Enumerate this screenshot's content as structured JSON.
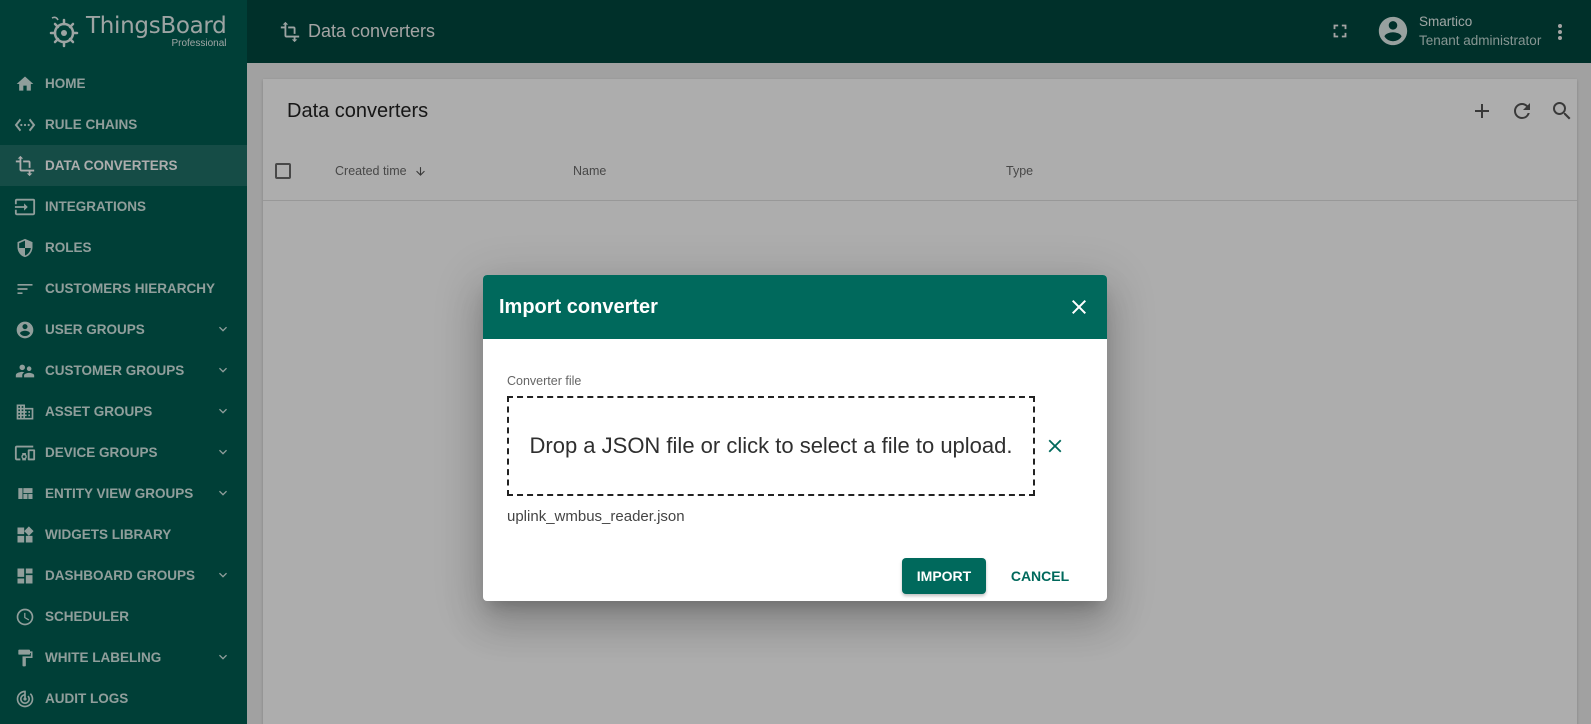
{
  "app": {
    "brand": "ThingsBoard",
    "edition": "Professional"
  },
  "sidebar": {
    "items": [
      {
        "label": "HOME",
        "icon": "home-icon"
      },
      {
        "label": "RULE CHAINS",
        "icon": "settings-ethernet-icon"
      },
      {
        "label": "DATA CONVERTERS",
        "icon": "transform-icon",
        "active": true
      },
      {
        "label": "INTEGRATIONS",
        "icon": "input-icon"
      },
      {
        "label": "ROLES",
        "icon": "shield-icon"
      },
      {
        "label": "CUSTOMERS HIERARCHY",
        "icon": "sort-icon"
      },
      {
        "label": "USER GROUPS",
        "icon": "account-circle-icon",
        "expandable": true
      },
      {
        "label": "CUSTOMER GROUPS",
        "icon": "supervisor-account-icon",
        "expandable": true
      },
      {
        "label": "ASSET GROUPS",
        "icon": "domain-icon",
        "expandable": true
      },
      {
        "label": "DEVICE GROUPS",
        "icon": "devices-other-icon",
        "expandable": true
      },
      {
        "label": "ENTITY VIEW GROUPS",
        "icon": "view-quilt-icon",
        "expandable": true
      },
      {
        "label": "WIDGETS LIBRARY",
        "icon": "widgets-icon"
      },
      {
        "label": "DASHBOARD GROUPS",
        "icon": "dashboard-icon",
        "expandable": true
      },
      {
        "label": "SCHEDULER",
        "icon": "schedule-icon"
      },
      {
        "label": "WHITE LABELING",
        "icon": "format-paint-icon",
        "expandable": true
      },
      {
        "label": "AUDIT LOGS",
        "icon": "track-changes-icon"
      }
    ]
  },
  "header": {
    "title": "Data converters",
    "user_name": "Smartico",
    "user_role": "Tenant administrator"
  },
  "main": {
    "card_title": "Data converters",
    "columns": [
      "Created time",
      "Name",
      "Type"
    ]
  },
  "dialog": {
    "title": "Import converter",
    "field_label": "Converter file",
    "dropzone_text": "Drop a JSON file or click to select a file to upload.",
    "file_name": "uplink_wmbus_reader.json",
    "import_label": "IMPORT",
    "cancel_label": "CANCEL"
  },
  "colors": {
    "sidebar": "#005e52",
    "header": "#00483f",
    "primary": "#00695c"
  }
}
